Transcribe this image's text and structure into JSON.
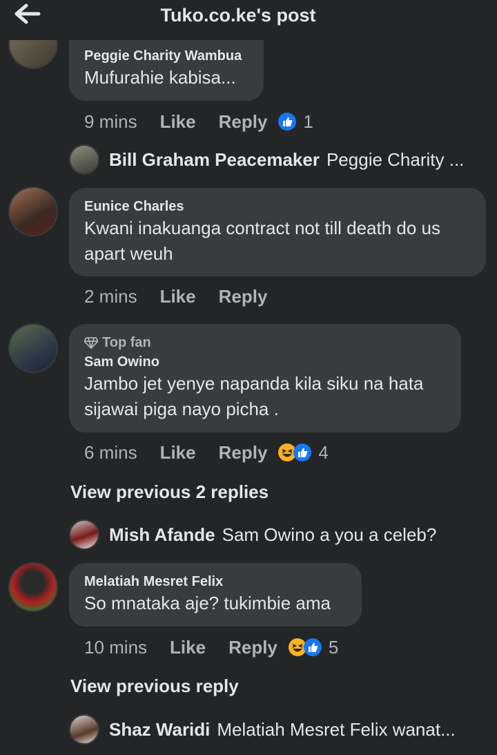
{
  "header": {
    "title": "Tuko.co.ke's post"
  },
  "comments": [
    {
      "author": "Peggie Charity Wambua",
      "text": "Mufurahie kabisa...",
      "time": "9 mins",
      "like_label": "Like",
      "reply_label": "Reply",
      "reaction_count": "1",
      "reactions": [
        "like-icon"
      ]
    },
    {
      "author": "Eunice Charles",
      "text": "Kwani inakuanga contract not till death do us apart weuh",
      "time": "2 mins",
      "like_label": "Like",
      "reply_label": "Reply"
    },
    {
      "badge": "Top fan",
      "author": "Sam Owino",
      "text": "Jambo jet yenye napanda kila siku na hata sijawai piga nayo picha .",
      "time": "6 mins",
      "like_label": "Like",
      "reply_label": "Reply",
      "reaction_count": "4",
      "reactions": [
        "haha-icon",
        "like-icon"
      ]
    },
    {
      "author": "Melatiah Mesret Felix",
      "text": "So mnataka aje? tukimbie ama",
      "time": "10 mins",
      "like_label": "Like",
      "reply_label": "Reply",
      "reaction_count": "5",
      "reactions": [
        "haha-icon",
        "like-icon"
      ]
    }
  ],
  "replies": [
    {
      "author": "Bill Graham Peacemaker",
      "text": "Peggie Charity ..."
    },
    {
      "author": "Mish Afande",
      "text": "Sam Owino a you a celeb?"
    },
    {
      "author": "Shaz Waridi",
      "text": "Melatiah Mesret Felix wanat..."
    }
  ],
  "view_previous": [
    "View previous 2 replies",
    "View previous reply"
  ],
  "colors": {
    "background": "#242526",
    "bubble": "#3a3b3c",
    "text": "#e4e6eb",
    "secondary": "#b0b3b8",
    "like_blue": "#1877f2",
    "haha_yellow": "#f7b125"
  }
}
